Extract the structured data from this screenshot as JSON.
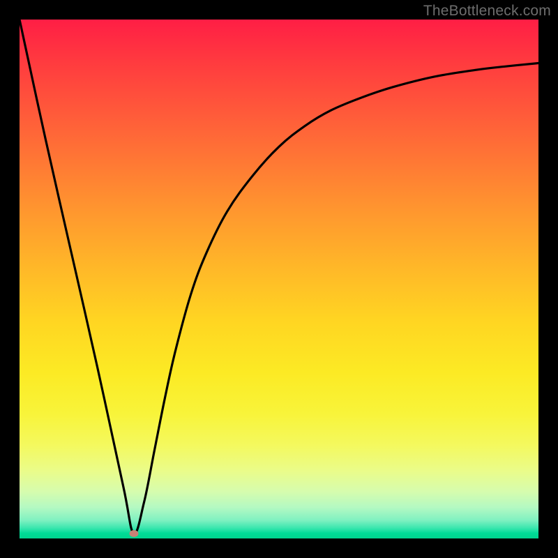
{
  "watermark": "TheBottleneck.com",
  "marker": {
    "x_pct": 22.0,
    "y_pct": 99.1
  },
  "chart_data": {
    "type": "line",
    "title": "",
    "xlabel": "",
    "ylabel": "",
    "xlim": [
      0,
      100
    ],
    "ylim": [
      0,
      100
    ],
    "series": [
      {
        "name": "curve",
        "x": [
          0,
          5,
          10,
          15,
          20,
          22,
          24,
          26,
          28,
          30,
          33,
          36,
          40,
          45,
          50,
          55,
          60,
          66,
          72,
          80,
          88,
          94,
          100
        ],
        "y": [
          100,
          77,
          55,
          33,
          10,
          1,
          7,
          17,
          27,
          36,
          47,
          55,
          63,
          70,
          75.5,
          79.5,
          82.5,
          85,
          87,
          89,
          90.3,
          91,
          91.6
        ]
      }
    ],
    "markers": [
      {
        "name": "minimum-dot",
        "x": 22.0,
        "y": 0.9
      }
    ],
    "background": {
      "type": "vertical-gradient",
      "stops": [
        {
          "pct": 0,
          "color": "#ff1e45"
        },
        {
          "pct": 38,
          "color": "#ff9a2e"
        },
        {
          "pct": 68,
          "color": "#fcea24"
        },
        {
          "pct": 94,
          "color": "#b4f9c2"
        },
        {
          "pct": 100,
          "color": "#00d48e"
        }
      ]
    }
  }
}
